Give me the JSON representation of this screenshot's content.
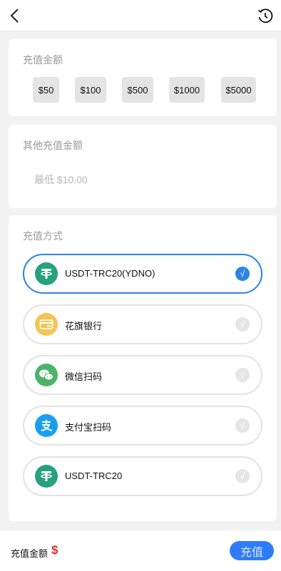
{
  "header": {
    "back_icon": "chevron-left-icon",
    "history_icon": "history-clock-icon"
  },
  "recharge_amount": {
    "title": "充值金额",
    "options": [
      "$50",
      "$100",
      "$500",
      "$1000",
      "$5000"
    ]
  },
  "other_amount": {
    "title": "其他充值金额",
    "placeholder": "最低 $10.00"
  },
  "payment_method": {
    "title": "充值方式",
    "methods": [
      {
        "label": "USDT-TRC20(YDNO)",
        "icon": "tether-icon",
        "selected": true
      },
      {
        "label": "花旗银行",
        "icon": "bank-card-icon",
        "selected": false
      },
      {
        "label": "微信扫码",
        "icon": "wechat-icon",
        "selected": false
      },
      {
        "label": "支付宝扫码",
        "icon": "alipay-icon",
        "selected": false
      },
      {
        "label": "USDT-TRC20",
        "icon": "tether-icon",
        "selected": false
      }
    ],
    "check_glyph": "√"
  },
  "footer": {
    "total_label": "充值金额",
    "currency_symbol": "$",
    "submit_label": "充值"
  },
  "colors": {
    "accent": "#2b84e3",
    "button": "#2f7df6",
    "price": "#e22b2b",
    "tether": "#26a17b",
    "bank": "#f6c453",
    "wechat": "#4cb36b",
    "alipay": "#1a9ff0"
  }
}
